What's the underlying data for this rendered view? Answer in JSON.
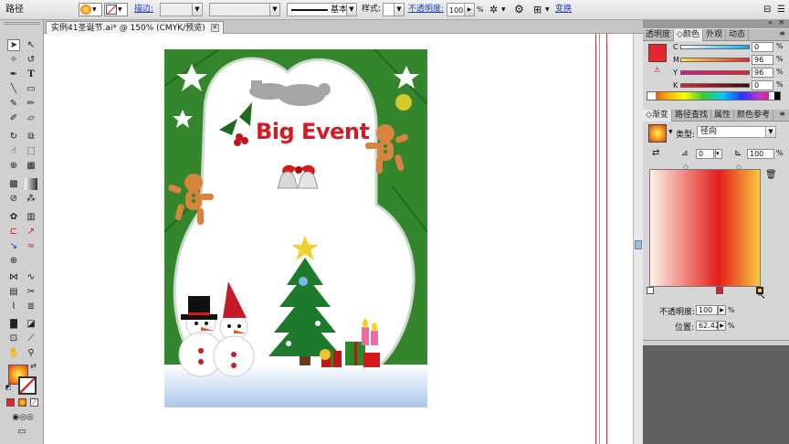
{
  "control_bar": {
    "object_type": "路径",
    "stroke_link": "描边:",
    "stroke_weight": "",
    "stroke_profile": "基本",
    "style_label": "样式:",
    "opacity_link": "不透明度:",
    "opacity_value": "100",
    "opacity_unit": "%",
    "transform_link": "变换"
  },
  "document_tab": {
    "title": "实例41圣诞节.ai* @ 150% (CMYK/预览)",
    "close": "✕"
  },
  "artwork": {
    "headline": "Big Event"
  },
  "color_panel": {
    "tabs": [
      "透明度",
      "颜色",
      "外观",
      "动态"
    ],
    "active_tab": "颜色",
    "fill_color": "#e5262a",
    "channels": [
      {
        "label": "C",
        "value": "0",
        "unit": "%"
      },
      {
        "label": "M",
        "value": "96",
        "unit": "%"
      },
      {
        "label": "Y",
        "value": "96",
        "unit": "%"
      },
      {
        "label": "K",
        "value": "0",
        "unit": "%"
      }
    ]
  },
  "gradient_panel": {
    "tabs": [
      "渐变",
      "路径查找",
      "属性",
      "颜色参考"
    ],
    "active_tab": "渐变",
    "type_label": "类型:",
    "type_value": "径向",
    "angle_value": "0",
    "aspect_value": "100",
    "aspect_unit": "%",
    "opacity_label": "不透明度:",
    "opacity_value": "100",
    "opacity_unit": "%",
    "location_label": "位置:",
    "location_value": "62.42",
    "location_unit": "%"
  },
  "colors": {
    "gradient_stops": [
      "#fdf2e8",
      "#e31e1b",
      "#f7c93d"
    ]
  }
}
